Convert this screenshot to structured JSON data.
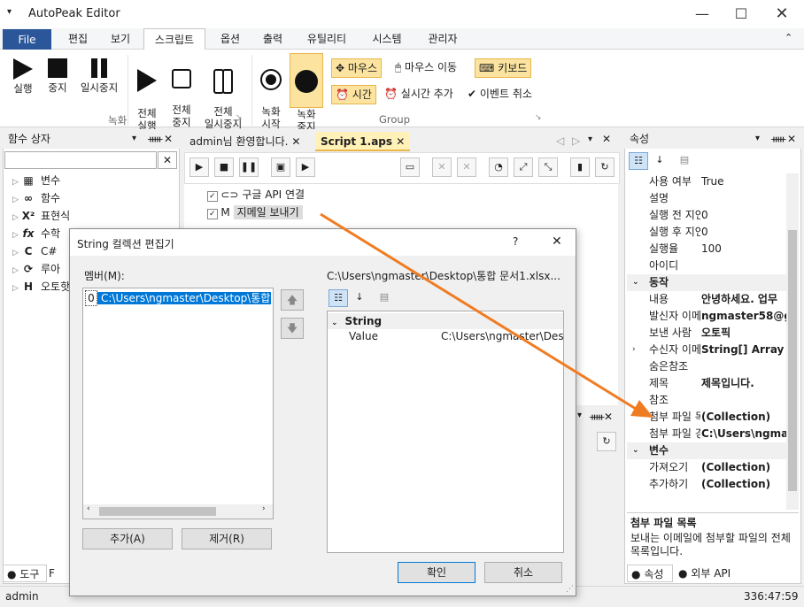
{
  "app": {
    "title": "AutoPeak Editor",
    "status_user": "admin",
    "status_time": "336:47:59"
  },
  "menu": {
    "file": "File",
    "tabs": [
      "편집",
      "보기",
      "스크립트",
      "옵션",
      "출력",
      "유틸리티",
      "시스템",
      "관리자"
    ]
  },
  "ribbon": {
    "run": "실행",
    "stop": "중지",
    "pause": "일시중지",
    "all_run": "전체\n실행",
    "all_stop": "전체\n중지",
    "all_pause": "전체\n일시중지",
    "group_record": "녹화",
    "rec_start": "녹화\n시작",
    "rec_stop": "녹화\n중지",
    "mouse": "마우스",
    "mouse_move": "마우스 이동",
    "keyboard": "키보드",
    "time": "시간",
    "realtime_add": "실시간 추가",
    "event_cancel": "이벤트 취소",
    "group_group": "Group"
  },
  "left_panel": {
    "title": "함수 상자",
    "search_placeholder": "",
    "items": [
      {
        "icon": "▦",
        "label": "변수"
      },
      {
        "icon": "∞",
        "label": "함수"
      },
      {
        "icon": "X²",
        "label": "표현식"
      },
      {
        "icon": "fx",
        "label": "수학"
      },
      {
        "icon": "C",
        "label": "C#"
      },
      {
        "icon": "⟳",
        "label": "루아"
      },
      {
        "icon": "H",
        "label": "오토핫"
      }
    ],
    "bottom_tabs": [
      "도구",
      "F"
    ]
  },
  "doc_tabs": [
    {
      "label": "admin님 환영합니다."
    },
    {
      "label": "Script 1.aps"
    }
  ],
  "script_nodes": [
    {
      "label": "구글 API 연결"
    },
    {
      "label": "지메일 보내기"
    }
  ],
  "properties": {
    "title": "속성",
    "rows": [
      {
        "type": "row",
        "k": "사용 여부",
        "v": "True"
      },
      {
        "type": "row",
        "k": "설명",
        "v": ""
      },
      {
        "type": "row",
        "k": "실행 전 지연",
        "v": "0"
      },
      {
        "type": "row",
        "k": "실행 후 지연",
        "v": "0"
      },
      {
        "type": "row",
        "k": "실행율",
        "v": "100"
      },
      {
        "type": "row",
        "k": "아이디",
        "v": ""
      },
      {
        "type": "cat",
        "k": "동작",
        "v": ""
      },
      {
        "type": "row",
        "k": "내용",
        "v": "안녕하세요. 업무"
      },
      {
        "type": "row",
        "k": "발신자 이메일",
        "v": "ngmaster58@gr"
      },
      {
        "type": "row",
        "k": "보낸 사람",
        "v": "오토픽"
      },
      {
        "type": "row",
        "k": "수신자 이메일",
        "v": "String[] Array"
      },
      {
        "type": "row",
        "k": "숨은참조",
        "v": ""
      },
      {
        "type": "row",
        "k": "제목",
        "v": "제목입니다."
      },
      {
        "type": "row",
        "k": "참조",
        "v": ""
      },
      {
        "type": "row",
        "k": "첨부 파일 목록",
        "v": "(Collection)"
      },
      {
        "type": "row",
        "k": "첨부 파일 경로",
        "v": "C:\\Users\\ngma"
      },
      {
        "type": "cat",
        "k": "변수",
        "v": ""
      },
      {
        "type": "row",
        "k": "가져오기",
        "v": "(Collection)"
      },
      {
        "type": "row",
        "k": "추가하기",
        "v": "(Collection)"
      }
    ],
    "desc_title": "첨부 파일 목록",
    "desc_text": "보내는 이메일에 첨부할 파일의 전체 목록입니다.",
    "bottom_tabs": [
      "속성",
      "외부 API"
    ]
  },
  "dialog": {
    "title": "String 컬렉션 편집기",
    "help": "?",
    "members_label": "멤버(M):",
    "member_index": "0",
    "member_value": "C:\\Users\\ngmaster\\Desktop\\통합",
    "path_label": "C:\\Users\\ngmaster\\Desktop\\통합 문서1.xlsx...",
    "prop_category": "String",
    "prop_key": "Value",
    "prop_value": "C:\\Users\\ngmaster\\Desk",
    "add": "추가(A)",
    "remove": "제거(R)",
    "ok": "확인",
    "cancel": "취소"
  },
  "colors": {
    "accent": "#2b579a",
    "highlight": "#fce4a0",
    "arrow": "#f07c22"
  }
}
